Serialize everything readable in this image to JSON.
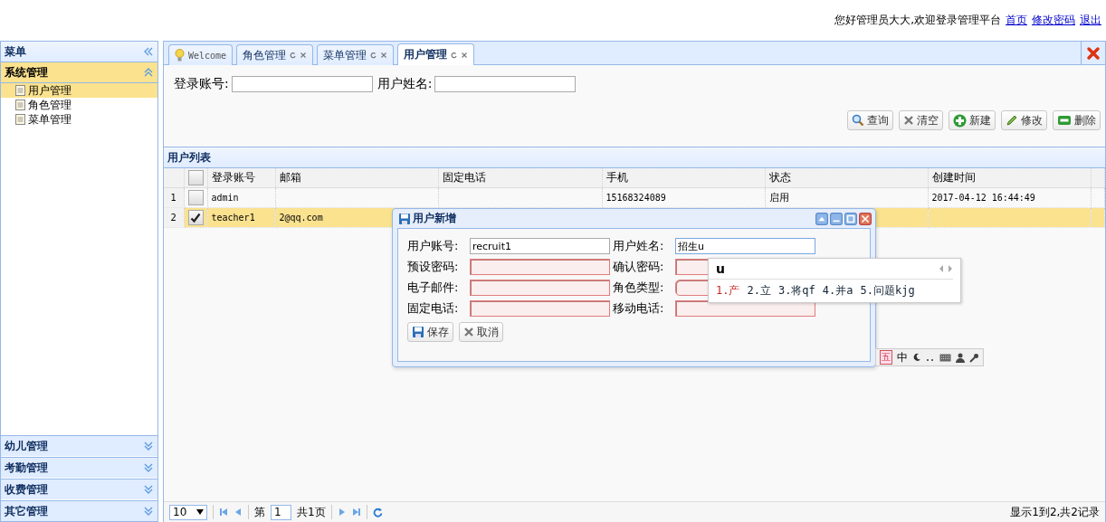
{
  "header": {
    "greeting": "您好管理员大大,欢迎登录管理平台",
    "links": [
      "首页",
      "修改密码",
      "退出"
    ]
  },
  "sidebar": {
    "title": "菜单",
    "groups": [
      {
        "title": "系统管理",
        "expanded": true,
        "items": [
          {
            "label": "用户管理",
            "selected": true
          },
          {
            "label": "角色管理",
            "selected": false
          },
          {
            "label": "菜单管理",
            "selected": false
          }
        ]
      },
      {
        "title": "幼儿管理",
        "expanded": false
      },
      {
        "title": "考勤管理",
        "expanded": false
      },
      {
        "title": "收费管理",
        "expanded": false
      },
      {
        "title": "其它管理",
        "expanded": false
      }
    ]
  },
  "tabs": [
    {
      "label": "Welcome",
      "kind": "home",
      "selected": false
    },
    {
      "label": "角色管理",
      "kind": "page",
      "selected": false
    },
    {
      "label": "菜单管理",
      "kind": "page",
      "selected": false
    },
    {
      "label": "用户管理",
      "kind": "page",
      "selected": true
    }
  ],
  "search": {
    "fields": [
      {
        "label": "登录账号:"
      },
      {
        "label": "用户姓名:"
      }
    ]
  },
  "toolbar": [
    {
      "label": "查询",
      "kind": "search"
    },
    {
      "label": "清空",
      "kind": "clear"
    },
    {
      "label": "新建",
      "kind": "add"
    },
    {
      "label": "修改",
      "kind": "edit"
    },
    {
      "label": "删除",
      "kind": "remove"
    }
  ],
  "grid": {
    "title": "用户列表",
    "all_checked": false,
    "columns": [
      {
        "title": "登录账号",
        "kind": "mono"
      },
      {
        "title": "邮箱",
        "kind": "mono"
      },
      {
        "title": "固定电话",
        "kind": "mono"
      },
      {
        "title": "手机",
        "kind": "mono"
      },
      {
        "title": "状态",
        "kind": "plain"
      },
      {
        "title": "创建时间",
        "kind": "mono"
      }
    ],
    "rows": [
      {
        "number": "1",
        "checked": false,
        "selected": false,
        "cells": [
          "admin",
          null,
          null,
          "15168324089",
          "启用",
          "2017-04-12 16:44:49"
        ]
      },
      {
        "number": "2",
        "checked": true,
        "selected": true,
        "cells": [
          "teacher1",
          "2@qq.com"
        ]
      }
    ]
  },
  "pager": {
    "page_size": "10",
    "before": "第",
    "page": "1",
    "after": "共1页",
    "summary": "显示1到2,共2记录"
  },
  "dialog": {
    "title": "用户新增",
    "fields": [
      {
        "label": "用户账号:",
        "value": "recruit1",
        "invalid": false,
        "focused": false,
        "kind": "text"
      },
      {
        "label": "用户姓名:",
        "value": "招生u",
        "invalid": false,
        "focused": true,
        "kind": "text"
      },
      {
        "label": "预设密码:",
        "invalid": true,
        "focused": false,
        "kind": "text"
      },
      {
        "label": "确认密码:",
        "invalid": true,
        "focused": false,
        "kind": "text"
      },
      {
        "label": "电子邮件:",
        "invalid": true,
        "focused": false,
        "kind": "text"
      },
      {
        "label": "角色类型:",
        "invalid": true,
        "focused": false,
        "kind": "combo"
      },
      {
        "label": "固定电话:",
        "invalid": true,
        "focused": false,
        "kind": "text"
      },
      {
        "label": "移动电话:",
        "invalid": true,
        "focused": false,
        "kind": "text"
      }
    ],
    "buttons": [
      {
        "label": "保存",
        "kind": "save"
      },
      {
        "label": "取消",
        "kind": "cancel"
      }
    ]
  },
  "ime": {
    "input": "u",
    "candidates": [
      {
        "text": "1.产",
        "selected": true
      },
      {
        "text": "2.立",
        "selected": false
      },
      {
        "text": "3.将qf",
        "selected": false
      },
      {
        "text": "4.并a",
        "selected": false
      },
      {
        "text": "5.问题kjg",
        "selected": false
      }
    ],
    "status": [
      "五",
      "中"
    ]
  }
}
